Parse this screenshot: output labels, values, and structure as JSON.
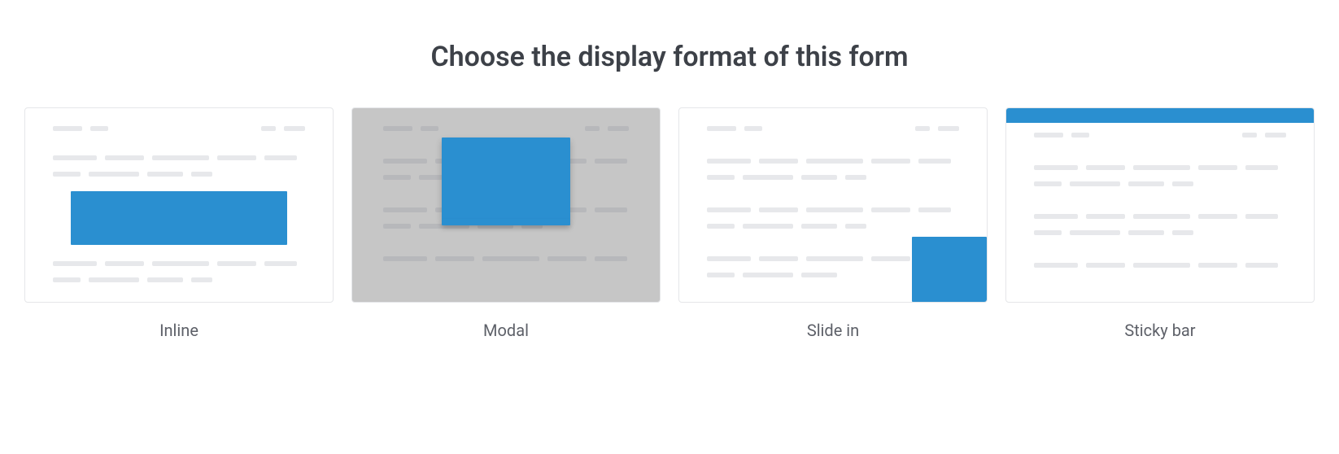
{
  "heading": "Choose the display format of this form",
  "options": [
    {
      "id": "inline",
      "label": "Inline"
    },
    {
      "id": "modal",
      "label": "Modal"
    },
    {
      "id": "slidein",
      "label": "Slide in"
    },
    {
      "id": "stickybar",
      "label": "Sticky bar"
    }
  ],
  "colors": {
    "accent": "#2a8fd0",
    "placeholder": "#e7e8eb",
    "modal_overlay": "#c6c6c6"
  }
}
